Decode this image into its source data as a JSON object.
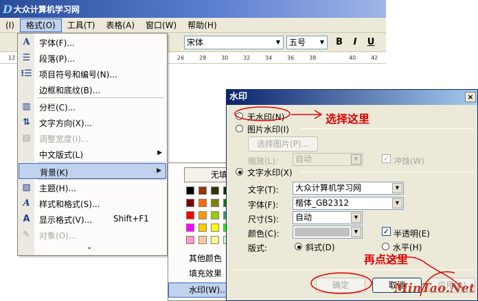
{
  "site_logo": {
    "mark": "D",
    "text": "大众计算机学习网"
  },
  "menubar": {
    "items": [
      "(I)",
      "格式(O)",
      "工具(T)",
      "表格(A)",
      "窗口(W)",
      "帮助(H)"
    ]
  },
  "toolbar": {
    "font_name": "宋体",
    "font_size": "五号",
    "bold": "B",
    "italic": "I",
    "underline": "U"
  },
  "ruler": {
    "numbers": [
      "12",
      "26",
      "28",
      "30",
      "32",
      "34",
      "36",
      "38",
      "40",
      "42"
    ]
  },
  "format_menu": {
    "items": [
      {
        "label": "字体(F)...",
        "icon": "font-a-icon"
      },
      {
        "label": "段落(P)...",
        "icon": "paragraph-icon"
      },
      {
        "label": "项目符号和编号(N)...",
        "icon": "bullets-icon"
      },
      {
        "label": "边框和底纹(B)...",
        "icon": ""
      },
      {
        "label": "分栏(C)...",
        "icon": "columns-icon"
      },
      {
        "label": "文字方向(X)...",
        "icon": "text-direction-icon"
      },
      {
        "label": "调整宽度(I)...",
        "icon": "adjust-width-icon"
      },
      {
        "label": "中文版式(L)",
        "icon": ""
      },
      {
        "label": "背景(K)",
        "icon": ""
      },
      {
        "label": "主题(H)...",
        "icon": "theme-icon"
      },
      {
        "label": "样式和格式(S)...",
        "icon": "styles-icon"
      },
      {
        "label": "显示格式(V)...",
        "icon": "reveal-format-icon"
      },
      {
        "label": "对象(O)...",
        "icon": "object-icon"
      }
    ],
    "reveal_shortcut": "Shift+F1"
  },
  "background_menu": {
    "no_fill": "无填",
    "more_colors": "其他颜色",
    "fill_effects": "填充效果",
    "watermark": "水印(W)..."
  },
  "dialog": {
    "title": "水印",
    "close": "×",
    "no_watermark": "无水印(N)",
    "picture_watermark": "图片水印(I)",
    "select_picture": "选择图片(P)...",
    "scale_label": "缩放(L):",
    "scale_value": "自动",
    "washout": "冲蚀(W)",
    "text_watermark": "文字水印(X)",
    "text_label": "文字(T):",
    "text_value": "大众计算机学习网",
    "font_label": "字体(F):",
    "font_value": "楷体_GB2312",
    "size_label": "尺寸(S):",
    "size_value": "自动",
    "color_label": "颜色(C):",
    "semi_transparent": "半透明(E)",
    "layout_label": "版式:",
    "diagonal": "斜式(D)",
    "horizontal": "水平(H)",
    "ok": "确定",
    "cancel": "取消",
    "apply": "应用(A)"
  },
  "annotations": {
    "select_here": "选择这里",
    "click_again": "再点这里",
    "site": "MinTao.Net"
  },
  "colors": {
    "accent": "#316ac5",
    "annotation": "#e00000",
    "swatches": [
      [
        "#000000",
        "#993300",
        "#333300",
        "#003300",
        "#003366"
      ],
      [
        "#800000",
        "#ff6600",
        "#808000",
        "#008000",
        "#008080"
      ],
      [
        "#ff0000",
        "#ff9900",
        "#99cc00",
        "#339966",
        "#33cccc"
      ],
      [
        "#ff00ff",
        "#ffcc00",
        "#ffff00",
        "#00ff00",
        "#00ffff"
      ],
      [
        "#ff99cc",
        "#ffcc99",
        "#ffff99",
        "#ccffcc",
        "#ccffff"
      ]
    ]
  }
}
